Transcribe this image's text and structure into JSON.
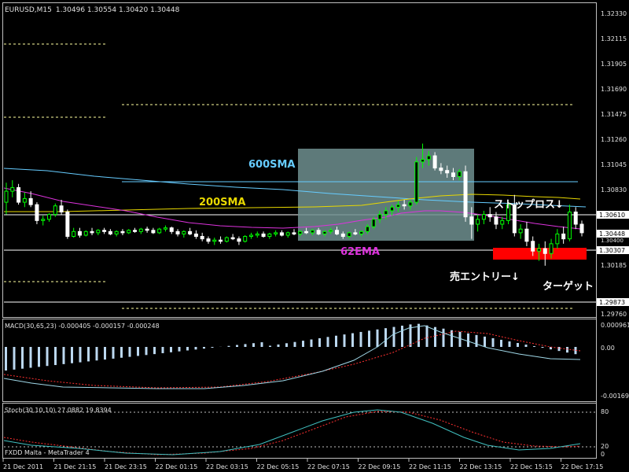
{
  "header": {
    "symbol_tf": "EURUSD,M15",
    "ohlc": "1.30496 1.30554 1.30420 1.30448",
    "macd_label": "MACD(30,65,23) -0.000405 -0.000157 -0.000248",
    "stoch_label": "Stoch(30,10,10) 27.0882 19.8394",
    "broker": "FXDD Malta - MetaTrader 4"
  },
  "annotations": {
    "sma600": "600SMA",
    "sma200": "200SMA",
    "ema62": "62EMA",
    "stop_loss": "ストップロス↓",
    "sell_entry": "売エントリー↓",
    "target": "ターゲット"
  },
  "colors": {
    "bull": "#00ff00",
    "bear": "#ffffff",
    "sma600": "#66ccff",
    "sma200": "#e8d800",
    "ema62": "#dd33dd",
    "level": "#ffffa0",
    "zone": "#6f8f8f",
    "target_box": "#ff0000",
    "macd_hist": "#bcd8f0",
    "macd_signal": "#ff3030",
    "stoch_main": "#40c0c0",
    "stoch_signal": "#ff3030"
  },
  "price_axis": {
    "ticks": [
      "1.32330",
      "1.32115",
      "1.31905",
      "1.31690",
      "1.31475",
      "1.31260",
      "1.31045",
      "1.30830",
      "1.30185",
      "1.29760"
    ],
    "tags": {
      "level_1": "1.30610",
      "current": "1.30448",
      "level_3": "1.30307",
      "level_4": "1.29873",
      "small": "1.30400"
    }
  },
  "macd_axis": {
    "ticks": [
      "0.000961",
      "0.00",
      "-0.00169"
    ]
  },
  "stoch_axis": {
    "ticks": [
      "80",
      "20",
      "0"
    ]
  },
  "time_axis": [
    "21 Dec 2011",
    "21 Dec 21:15",
    "21 Dec 23:15",
    "22 Dec 01:15",
    "22 Dec 03:15",
    "22 Dec 05:15",
    "22 Dec 07:15",
    "22 Dec 09:15",
    "22 Dec 11:15",
    "22 Dec 13:15",
    "22 Dec 15:15",
    "22 Dec 17:15"
  ],
  "chart_data": {
    "type": "candlestick",
    "symbol": "EURUSD",
    "timeframe": "M15",
    "ylim": [
      1.2976,
      1.3233
    ],
    "candles_ohlc": [
      [
        1.307,
        1.3086,
        1.306,
        1.3079
      ],
      [
        1.3079,
        1.3088,
        1.3074,
        1.3082
      ],
      [
        1.3082,
        1.3085,
        1.3068,
        1.307
      ],
      [
        1.307,
        1.3078,
        1.3066,
        1.3073
      ],
      [
        1.3073,
        1.3079,
        1.3066,
        1.3068
      ],
      [
        1.3068,
        1.307,
        1.3052,
        1.3055
      ],
      [
        1.3055,
        1.3059,
        1.3051,
        1.3056
      ],
      [
        1.3056,
        1.3061,
        1.3054,
        1.306
      ],
      [
        1.306,
        1.3069,
        1.3058,
        1.3067
      ],
      [
        1.3067,
        1.3072,
        1.306,
        1.3062
      ],
      [
        1.3062,
        1.3064,
        1.304,
        1.3042
      ],
      [
        1.3042,
        1.3049,
        1.3041,
        1.3046
      ],
      [
        1.3046,
        1.3049,
        1.3041,
        1.3043
      ],
      [
        1.3043,
        1.3047,
        1.3042,
        1.3046
      ],
      [
        1.3046,
        1.3049,
        1.3043,
        1.3045
      ],
      [
        1.3045,
        1.3048,
        1.3043,
        1.3047
      ],
      [
        1.3047,
        1.3049,
        1.3044,
        1.3046
      ],
      [
        1.3046,
        1.3048,
        1.3043,
        1.3044
      ],
      [
        1.3044,
        1.3047,
        1.3042,
        1.3046
      ],
      [
        1.3046,
        1.3048,
        1.3043,
        1.3045
      ],
      [
        1.3045,
        1.3048,
        1.3044,
        1.3047
      ],
      [
        1.3047,
        1.3049,
        1.3045,
        1.3046
      ],
      [
        1.3046,
        1.3049,
        1.3044,
        1.3048
      ],
      [
        1.3048,
        1.305,
        1.3045,
        1.3047
      ],
      [
        1.3047,
        1.3049,
        1.3044,
        1.3045
      ],
      [
        1.3045,
        1.3049,
        1.3044,
        1.3048
      ],
      [
        1.3048,
        1.3051,
        1.3046,
        1.3049
      ],
      [
        1.3049,
        1.305,
        1.3044,
        1.3046
      ],
      [
        1.3046,
        1.3048,
        1.3042,
        1.3044
      ],
      [
        1.3044,
        1.3047,
        1.3041,
        1.3046
      ],
      [
        1.3046,
        1.3049,
        1.3043,
        1.3044
      ],
      [
        1.3044,
        1.3047,
        1.304,
        1.3042
      ],
      [
        1.3042,
        1.3045,
        1.3038,
        1.304
      ],
      [
        1.304,
        1.3042,
        1.3036,
        1.3038
      ],
      [
        1.3038,
        1.3041,
        1.3035,
        1.3039
      ],
      [
        1.3039,
        1.3042,
        1.3036,
        1.3038
      ],
      [
        1.3038,
        1.3042,
        1.3037,
        1.3041
      ],
      [
        1.3041,
        1.3044,
        1.3039,
        1.304
      ],
      [
        1.304,
        1.3042,
        1.3035,
        1.3038
      ],
      [
        1.3038,
        1.3043,
        1.3037,
        1.3042
      ],
      [
        1.3042,
        1.3045,
        1.304,
        1.3043
      ],
      [
        1.3043,
        1.3046,
        1.3041,
        1.3044
      ],
      [
        1.3044,
        1.3046,
        1.3041,
        1.3042
      ],
      [
        1.3042,
        1.3045,
        1.304,
        1.3044
      ],
      [
        1.3044,
        1.3047,
        1.3042,
        1.3045
      ],
      [
        1.3045,
        1.3047,
        1.3042,
        1.3043
      ],
      [
        1.3043,
        1.3046,
        1.3041,
        1.3045
      ],
      [
        1.3045,
        1.3048,
        1.3043,
        1.3044
      ],
      [
        1.3044,
        1.3047,
        1.3042,
        1.3046
      ],
      [
        1.3046,
        1.3049,
        1.3044,
        1.3045
      ],
      [
        1.3045,
        1.3048,
        1.3043,
        1.3047
      ],
      [
        1.3047,
        1.3049,
        1.3043,
        1.3044
      ],
      [
        1.3044,
        1.3047,
        1.3042,
        1.3046
      ],
      [
        1.3046,
        1.3049,
        1.3044,
        1.3047
      ],
      [
        1.3047,
        1.305,
        1.3043,
        1.3044
      ],
      [
        1.3044,
        1.3046,
        1.304,
        1.3042
      ],
      [
        1.3042,
        1.3046,
        1.304,
        1.3045
      ],
      [
        1.3045,
        1.3048,
        1.3043,
        1.3044
      ],
      [
        1.3044,
        1.3047,
        1.3042,
        1.3046
      ],
      [
        1.3046,
        1.3052,
        1.3044,
        1.305
      ],
      [
        1.305,
        1.3058,
        1.3048,
        1.3056
      ],
      [
        1.3056,
        1.3063,
        1.3053,
        1.306
      ],
      [
        1.306,
        1.3066,
        1.3056,
        1.3063
      ],
      [
        1.3063,
        1.3068,
        1.3059,
        1.3066
      ],
      [
        1.3066,
        1.3071,
        1.3062,
        1.3068
      ],
      [
        1.3068,
        1.3072,
        1.3064,
        1.3067
      ],
      [
        1.3067,
        1.3072,
        1.3064,
        1.307
      ],
      [
        1.307,
        1.3107,
        1.3068,
        1.3103
      ],
      [
        1.3103,
        1.3118,
        1.3098,
        1.3105
      ],
      [
        1.3105,
        1.3112,
        1.31,
        1.3108
      ],
      [
        1.3108,
        1.3111,
        1.3096,
        1.3098
      ],
      [
        1.3098,
        1.3102,
        1.3093,
        1.3096
      ],
      [
        1.3096,
        1.31,
        1.309,
        1.3094
      ],
      [
        1.3094,
        1.3098,
        1.3088,
        1.3091
      ],
      [
        1.3091,
        1.3097,
        1.3088,
        1.3095
      ],
      [
        1.3095,
        1.31,
        1.3054,
        1.3058
      ],
      [
        1.3058,
        1.3066,
        1.304,
        1.3052
      ],
      [
        1.3052,
        1.306,
        1.3046,
        1.3056
      ],
      [
        1.3056,
        1.3063,
        1.3052,
        1.306
      ],
      [
        1.306,
        1.3066,
        1.3054,
        1.3058
      ],
      [
        1.3058,
        1.3062,
        1.3048,
        1.3052
      ],
      [
        1.3052,
        1.3058,
        1.3048,
        1.3055
      ],
      [
        1.3055,
        1.307,
        1.3052,
        1.3068
      ],
      [
        1.3068,
        1.3076,
        1.3042,
        1.3045
      ],
      [
        1.3045,
        1.3052,
        1.304,
        1.3048
      ],
      [
        1.3048,
        1.3054,
        1.3034,
        1.3038
      ],
      [
        1.3038,
        1.3042,
        1.3026,
        1.303
      ],
      [
        1.303,
        1.3036,
        1.3022,
        1.3032
      ],
      [
        1.3032,
        1.3038,
        1.3018,
        1.3028
      ],
      [
        1.3028,
        1.304,
        1.3024,
        1.3036
      ],
      [
        1.3036,
        1.3048,
        1.3032,
        1.3044
      ],
      [
        1.3044,
        1.305,
        1.3036,
        1.304
      ],
      [
        1.304,
        1.3068,
        1.3038,
        1.3062
      ],
      [
        1.3062,
        1.3066,
        1.3048,
        1.3052
      ],
      [
        1.3052,
        1.3055,
        1.3042,
        1.3045
      ]
    ],
    "series": [
      {
        "name": "600SMA",
        "values": [
          1.3115,
          1.3085
        ]
      },
      {
        "name": "200SMA",
        "values": [
          1.3069,
          1.3078
        ]
      },
      {
        "name": "62EMA"
      }
    ],
    "levels": [
      1.3061,
      1.30307,
      1.29873
    ],
    "macd": {
      "main": -0.000405,
      "signal": -0.000157,
      "hist": -0.000248
    },
    "stoch": {
      "k": 27.0882,
      "d": 19.8394,
      "levels": [
        80,
        20
      ]
    }
  }
}
